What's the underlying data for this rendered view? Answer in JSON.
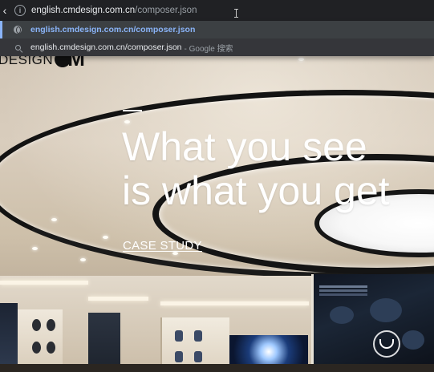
{
  "browser": {
    "back_icon": "chevron-left-icon",
    "site_info_icon": "info-icon",
    "url_host": "english.cmdesign.com.cn",
    "url_path": "/composer.json",
    "suggestions": [
      {
        "icon": "globe-icon",
        "text": "english.cmdesign.com.cn/composer.json",
        "hint": ""
      },
      {
        "icon": "search-icon",
        "text": "english.cmdesign.com.cn/composer.json",
        "hint": "- Google 搜索"
      }
    ]
  },
  "site": {
    "logo_text": "DESIGN",
    "logo_mark": "M",
    "headline_line1": "What you see",
    "headline_line2": "is what you get",
    "cta_label": "CASE STUDY"
  },
  "colors": {
    "omnibox_bg": "#202124",
    "dropdown_bg": "#35363a",
    "link_blue": "#8ab4f8",
    "headline_white": "#ffffff"
  }
}
